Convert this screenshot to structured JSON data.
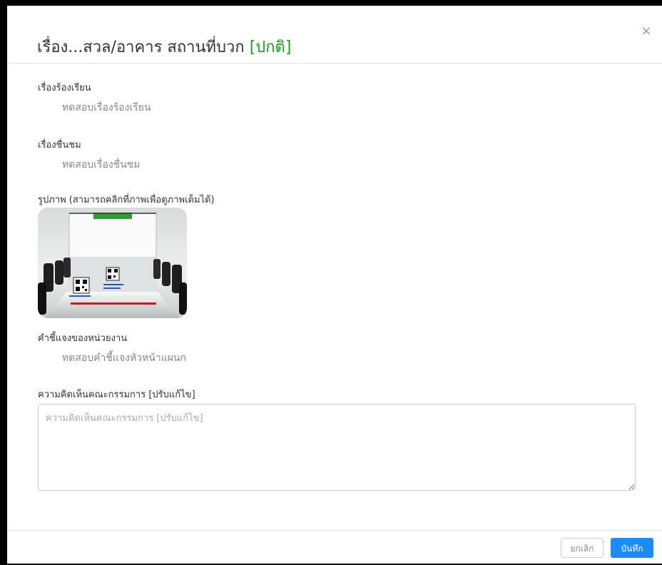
{
  "modal": {
    "title": "เรื่อง...สวล/อาคาร สถานที่บวก",
    "status_tag": "[ปกติ]",
    "close_glyph": "×"
  },
  "sections": {
    "complaint_label": "เรื่องร้องเรียน",
    "complaint_value": "ทดสอบเรื่องร้องเรียน",
    "praise_label": "เรื่องชื่นชม",
    "praise_value": "ทดสอบเรื่องชื่นชม",
    "image_label": "รูปภาพ (สามารถคลิกที่ภาพเพื่อดูภาพเต็มได้)",
    "agency_label": "คำชี้แจงของหน่วยงาน",
    "agency_value": "ทดสอบคำชี้แจงหัวหน้าแผนก",
    "committee_label": "ความคิดเห็นคณะกรรมการ [ปรับแก้ไข]"
  },
  "committee_input": {
    "value": "",
    "placeholder": "ความคิดเห็นคณะกรรมการ [ปรับแก้ไข]"
  },
  "footer": {
    "cancel_label": "ยกเลิก",
    "save_label": "บันทึก"
  },
  "colors": {
    "status_green": "#19a319",
    "primary_blue": "#1a8cff"
  }
}
